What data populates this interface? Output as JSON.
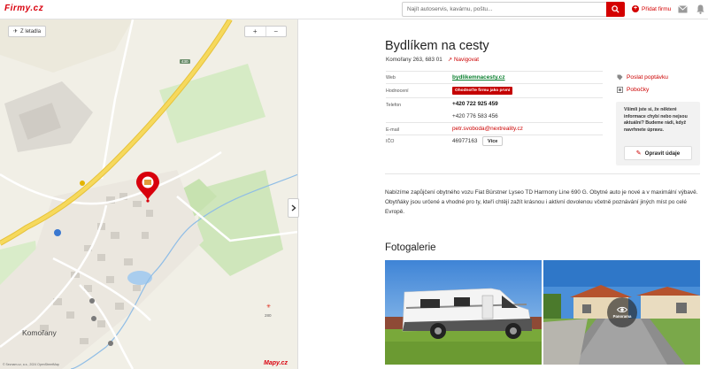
{
  "header": {
    "logo": "Firmy.cz",
    "search_placeholder": "Najít autoservis, kavárnu, poštu...",
    "add_firm_label": "Přidat firmu"
  },
  "map": {
    "back_label": "Z letadla",
    "zoom_in": "+",
    "zoom_out": "−",
    "town_label": "Komořany",
    "road_number": "430",
    "logo": "Mapy.cz",
    "copyright": "© Seznam.cz, a.s., 2024 OpenStreetMap"
  },
  "business": {
    "name": "Bydlíkem na cesty",
    "address": "Komořany 263, 683 01",
    "navigate_label": "Navigovat"
  },
  "details": {
    "web_label": "Web",
    "web_value": "bydlikemnacesty.cz",
    "rating_label": "Hodnocení",
    "rating_button": "Ohodnoťte firmu jako první",
    "phone_label": "Telefon",
    "phone_1": "+420 722 925 459",
    "phone_2": "+420 776 583 456",
    "email_label": "E-mail",
    "email_value": "petr.svoboda@nextreality.cz",
    "ico_label": "IČO",
    "ico_value": "46977163",
    "more_button": "Více"
  },
  "side": {
    "inquiry_label": "Poslat poptávku",
    "branches_label": "Pobočky",
    "note": "Všimli jste si, že některé informace chybí nebo nejsou aktuální? Budeme rádi, když navrhnete úpravu.",
    "edit_button": "Opravit údaje"
  },
  "description": "Nabízíme zapůjčení obytného vozu Fiat Bürstner Lyseo TD Harmony Line 690 G. Obytné auto je nové a v maximální výbavě. Obytňáky jsou určené a vhodné pro ty, kteří chtějí zažít krásnou i aktivní dovolenou včetně poznávání jiných míst po celé Evropě.",
  "gallery": {
    "title": "Fotogalerie",
    "panorama_label": "Panorama"
  },
  "colors": {
    "accent": "#d40000",
    "web_link": "#0a7f2e"
  }
}
